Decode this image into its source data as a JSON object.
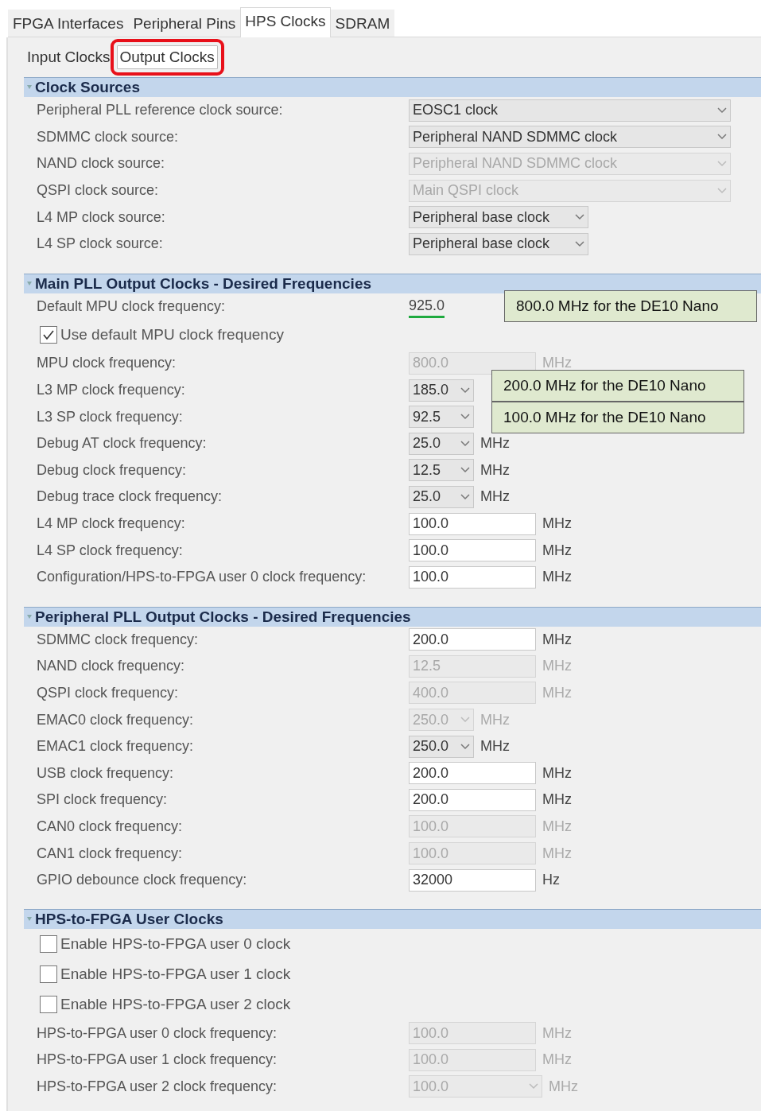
{
  "tabs": [
    {
      "label": "FPGA Interfaces",
      "selected": false
    },
    {
      "label": "Peripheral Pins",
      "selected": false
    },
    {
      "label": "HPS Clocks",
      "selected": true
    },
    {
      "label": "SDRAM",
      "selected": false
    }
  ],
  "subtabs": [
    {
      "label": "Input Clocks",
      "selected": false,
      "highlighted": false
    },
    {
      "label": "Output Clocks",
      "selected": true,
      "highlighted": true
    }
  ],
  "sections": [
    {
      "title": "Clock Sources",
      "rows": [
        {
          "kind": "wide_select",
          "label": "Peripheral PLL reference clock source:",
          "value": "EOSC1 clock",
          "disabled": false
        },
        {
          "kind": "wide_select",
          "label": "SDMMC clock source:",
          "value": "Peripheral NAND SDMMC clock",
          "disabled": false
        },
        {
          "kind": "wide_select",
          "label": "NAND clock source:",
          "value": "Peripheral NAND SDMMC clock",
          "disabled": true
        },
        {
          "kind": "wide_select",
          "label": "QSPI clock source:",
          "value": "Main QSPI clock",
          "disabled": true
        },
        {
          "kind": "select",
          "label": "L4 MP clock source:",
          "value": "Peripheral base clock",
          "disabled": false
        },
        {
          "kind": "select",
          "label": "L4 SP clock source:",
          "value": "Peripheral base clock",
          "disabled": false
        }
      ]
    },
    {
      "title": "Main PLL Output Clocks - Desired Frequencies",
      "rows": [
        {
          "kind": "value",
          "label": "Default MPU clock frequency:",
          "value": "925.0",
          "highlighted": true,
          "note": "800.0 MHz for the DE10 Nano"
        },
        {
          "kind": "checkbox",
          "label": "Use default MPU clock frequency",
          "checked": true
        },
        {
          "kind": "field",
          "label": "MPU clock frequency:",
          "value": "800.0",
          "unit": "MHz",
          "disabled": true
        },
        {
          "kind": "combo",
          "label": "L3 MP clock frequency:",
          "value": "185.0",
          "disabled": false,
          "note": "200.0 MHz for the DE10 Nano"
        },
        {
          "kind": "combo",
          "label": "L3 SP clock frequency:",
          "value": "92.5",
          "disabled": false,
          "note": "100.0 MHz for the DE10 Nano"
        },
        {
          "kind": "combo",
          "label": "Debug AT clock frequency:",
          "value": "25.0",
          "unit": "MHz",
          "disabled": false
        },
        {
          "kind": "combo",
          "label": "Debug clock frequency:",
          "value": "12.5",
          "unit": "MHz",
          "disabled": false
        },
        {
          "kind": "combo",
          "label": "Debug trace clock frequency:",
          "value": "25.0",
          "unit": "MHz",
          "disabled": false
        },
        {
          "kind": "field",
          "label": "L4 MP clock frequency:",
          "value": "100.0",
          "unit": "MHz",
          "disabled": false
        },
        {
          "kind": "field",
          "label": "L4 SP clock frequency:",
          "value": "100.0",
          "unit": "MHz",
          "disabled": false
        },
        {
          "kind": "field",
          "label": "Configuration/HPS-to-FPGA user 0 clock frequency:",
          "value": "100.0",
          "unit": "MHz",
          "disabled": false
        }
      ]
    },
    {
      "title": "Peripheral PLL Output Clocks - Desired Frequencies",
      "rows": [
        {
          "kind": "field",
          "label": "SDMMC clock frequency:",
          "value": "200.0",
          "unit": "MHz",
          "disabled": false
        },
        {
          "kind": "field",
          "label": "NAND clock frequency:",
          "value": "12.5",
          "unit": "MHz",
          "disabled": true
        },
        {
          "kind": "field",
          "label": "QSPI clock frequency:",
          "value": "400.0",
          "unit": "MHz",
          "disabled": true
        },
        {
          "kind": "combo",
          "label": "EMAC0 clock frequency:",
          "value": "250.0",
          "unit": "MHz",
          "disabled": true
        },
        {
          "kind": "combo",
          "label": "EMAC1 clock frequency:",
          "value": "250.0",
          "unit": "MHz",
          "disabled": false
        },
        {
          "kind": "field",
          "label": "USB clock frequency:",
          "value": "200.0",
          "unit": "MHz",
          "disabled": false
        },
        {
          "kind": "field",
          "label": "SPI clock frequency:",
          "value": "200.0",
          "unit": "MHz",
          "disabled": false
        },
        {
          "kind": "field",
          "label": "CAN0 clock frequency:",
          "value": "100.0",
          "unit": "MHz",
          "disabled": true
        },
        {
          "kind": "field",
          "label": "CAN1 clock frequency:",
          "value": "100.0",
          "unit": "MHz",
          "disabled": true
        },
        {
          "kind": "field",
          "label": "GPIO debounce clock frequency:",
          "value": "32000",
          "unit": "Hz",
          "disabled": false
        }
      ]
    },
    {
      "title": "HPS-to-FPGA User Clocks",
      "rows": [
        {
          "kind": "checkbox",
          "label": "Enable HPS-to-FPGA user 0 clock",
          "checked": false
        },
        {
          "kind": "checkbox",
          "label": "Enable HPS-to-FPGA user 1 clock",
          "checked": false
        },
        {
          "kind": "checkbox",
          "label": "Enable HPS-to-FPGA user 2 clock",
          "checked": false
        },
        {
          "kind": "field",
          "label": "HPS-to-FPGA user 0 clock frequency:",
          "value": "100.0",
          "unit": "MHz",
          "disabled": true
        },
        {
          "kind": "field",
          "label": "HPS-to-FPGA user 1 clock frequency:",
          "value": "100.0",
          "unit": "MHz",
          "disabled": true
        },
        {
          "kind": "wide_combo",
          "label": "HPS-to-FPGA user 2 clock frequency:",
          "value": "100.0",
          "unit": "MHz",
          "disabled": true
        }
      ]
    }
  ]
}
